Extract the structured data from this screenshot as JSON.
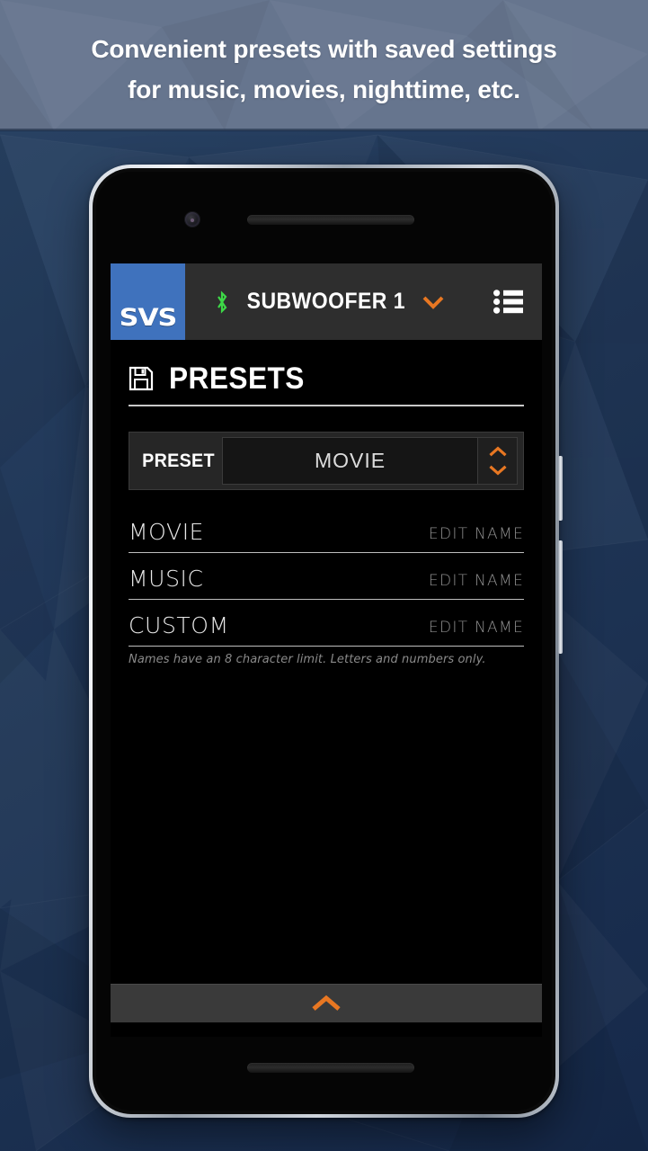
{
  "promo": {
    "line1": "Convenient presets with saved settings",
    "line2": "for music, movies, nighttime, etc.",
    "background_color": "#66758e",
    "text_color": "#ffffff"
  },
  "page": {
    "background_color": "#22395a"
  },
  "device": {
    "frame_color": "#c6ccd4",
    "screen_background": "#000000",
    "hardware": {
      "front_camera": "front-camera",
      "earpiece_speaker": "earpiece-speaker",
      "bottom_speaker": "bottom-speaker",
      "power_button": "power-button",
      "volume_button": "volume-button"
    }
  },
  "app_bar": {
    "logo_text": "SVS",
    "logo_background": "#3f72bd",
    "bar_background": "#2e2e2e",
    "bluetooth_icon": "bluetooth-icon",
    "bluetooth_color": "#3dd947",
    "device_name": "SUBWOOFER 1",
    "dropdown_icon": "chevron-down-icon",
    "dropdown_color": "#e87722",
    "menu_icon": "list-menu-icon"
  },
  "section": {
    "icon": "save-floppy-icon",
    "title": "PRESETS"
  },
  "preset_selector": {
    "label": "PRESET",
    "value": "MOVIE",
    "up_icon": "chevron-up-icon",
    "down_icon": "chevron-down-icon",
    "arrow_color": "#e87722"
  },
  "preset_list": {
    "edit_label": "EDIT NAME",
    "rows": [
      {
        "name": "MOVIE",
        "edit_label": "EDIT NAME"
      },
      {
        "name": "MUSIC",
        "edit_label": "EDIT NAME"
      },
      {
        "name": "CUSTOM",
        "edit_label": "EDIT NAME"
      }
    ],
    "hint": "Names have an 8 character limit. Letters and numbers only."
  },
  "bottom_drawer": {
    "icon": "chevron-up-icon",
    "icon_color": "#e87722"
  }
}
